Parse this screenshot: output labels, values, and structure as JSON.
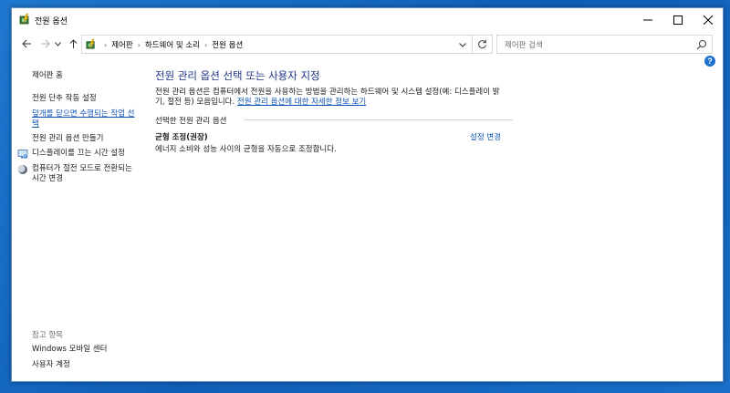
{
  "window": {
    "title": "전원 옵션"
  },
  "nav": {
    "breadcrumbs": [
      "제어판",
      "하드웨어 및 소리",
      "전원 옵션"
    ],
    "search_placeholder": "제어판 검색"
  },
  "sidebar": {
    "home": "제어판 홈",
    "tasks": [
      "전원 단추 작동 설정",
      "덮개를 닫으면 수행되는 작업 선택",
      "전원 관리 옵션 만들기",
      "디스플레이를 끄는 시간 설정",
      "컴퓨터가 절전 모드로 전환되는 시간 변경"
    ],
    "see_also_label": "참고 항목",
    "see_also": [
      "Windows 모바일 센터",
      "사용자 계정"
    ]
  },
  "main": {
    "title": "전원 관리 옵션 선택 또는 사용자 지정",
    "desc_line1": "전원 관리 옵션은 컴퓨터에서 전원을 사용하는 방법을 관리하는 하드웨어 및 시스템 설정(예: 디스플레이 밝",
    "desc_line2": "기, 절전 등) 모음입니다.",
    "desc_link": "전원 관리 옵션에 대한 자세한 정보 보기",
    "group_label": "선택한 전원 관리 옵션",
    "plan_name": "균형 조정(권장)",
    "plan_desc": "에너지 소비와 성능 사이의 균형을 자동으로 조정합니다.",
    "plan_change": "설정 변경"
  },
  "colors": {
    "link": "#0e54b4",
    "title": "#1e3287",
    "desktop": "#1a6fc8"
  }
}
